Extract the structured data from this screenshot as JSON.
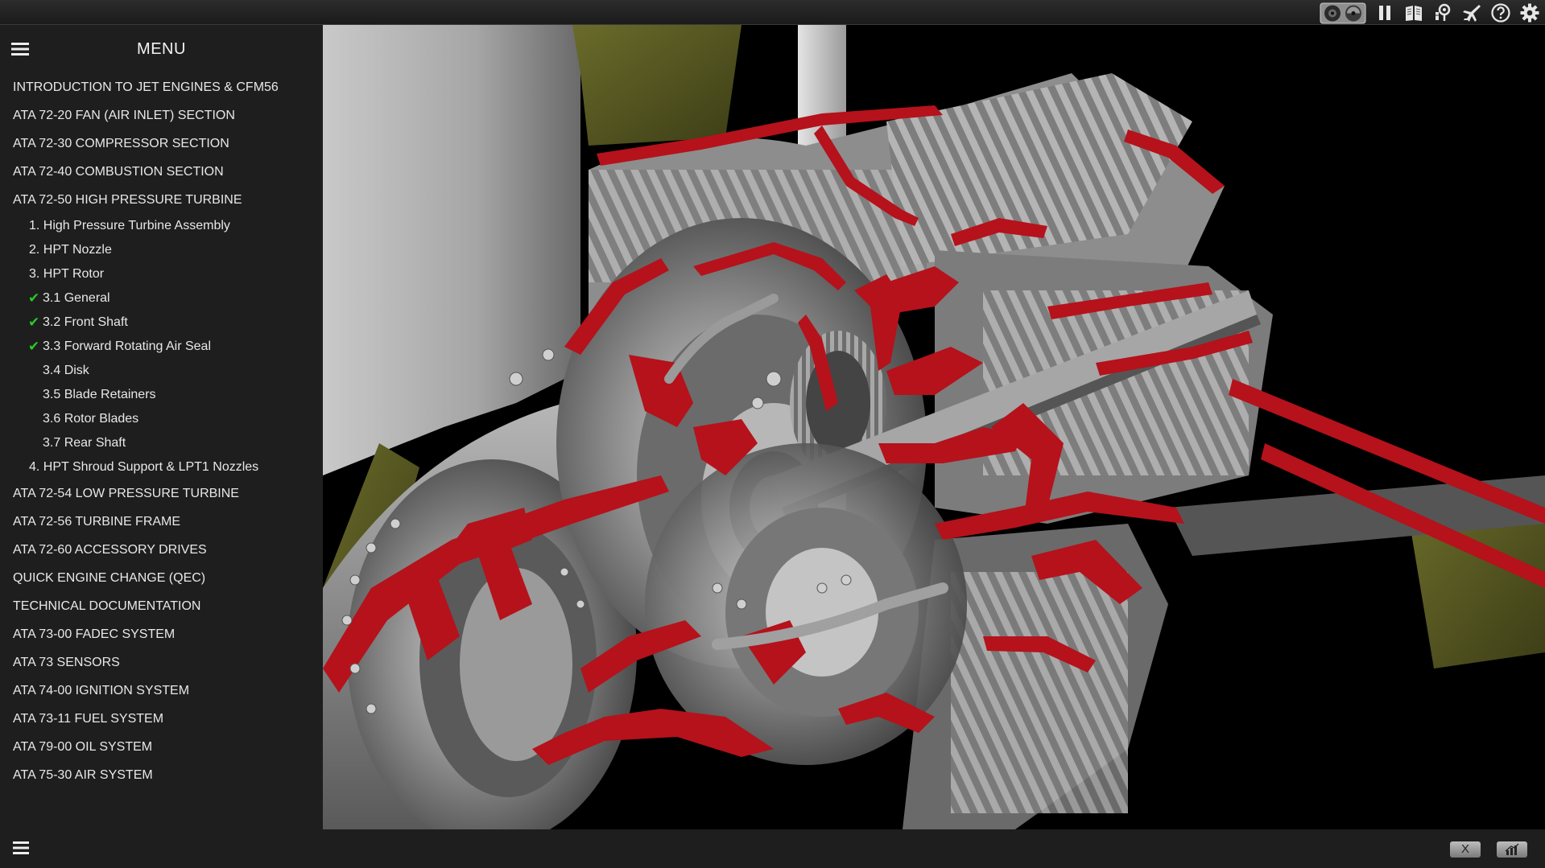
{
  "app": {
    "menu_title": "MENU"
  },
  "toolbar": {
    "icons": [
      "view-toggle-icon",
      "pause-icon",
      "book-icon",
      "location-pin-icon",
      "airplane-icon",
      "help-icon",
      "gear-icon"
    ]
  },
  "menu": {
    "items": [
      {
        "label": "INTRODUCTION TO JET ENGINES & CFM56",
        "level": 0
      },
      {
        "label": "ATA 72-20 FAN (AIR INLET) SECTION",
        "level": 0
      },
      {
        "label": "ATA 72-30 COMPRESSOR SECTION",
        "level": 0
      },
      {
        "label": "ATA 72-40 COMBUSTION SECTION",
        "level": 0
      },
      {
        "label": "ATA 72-50 HIGH PRESSURE TURBINE",
        "level": 0
      },
      {
        "label": "1. High Pressure Turbine Assembly",
        "level": 1
      },
      {
        "label": "2. HPT Nozzle",
        "level": 1
      },
      {
        "label": "3. HPT Rotor",
        "level": 1
      },
      {
        "label": "3.1 General",
        "level": 2,
        "checked": true
      },
      {
        "label": "3.2 Front Shaft",
        "level": 2,
        "checked": true
      },
      {
        "label": "3.3 Forward Rotating Air Seal",
        "level": 2,
        "checked": true
      },
      {
        "label": "3.4 Disk",
        "level": 2,
        "checked": false
      },
      {
        "label": "3.5 Blade Retainers",
        "level": 2,
        "checked": false
      },
      {
        "label": "3.6 Rotor Blades",
        "level": 2,
        "checked": false
      },
      {
        "label": "3.7 Rear Shaft",
        "level": 2,
        "checked": false
      },
      {
        "label": "4. HPT Shroud Support & LPT1 Nozzles",
        "level": 1
      },
      {
        "label": "ATA 72-54 LOW PRESSURE TURBINE",
        "level": 0
      },
      {
        "label": "ATA 72-56 TURBINE FRAME",
        "level": 0
      },
      {
        "label": "ATA 72-60 ACCESSORY DRIVES",
        "level": 0
      },
      {
        "label": "QUICK ENGINE CHANGE (QEC)",
        "level": 0
      },
      {
        "label": "TECHNICAL DOCUMENTATION",
        "level": 0
      },
      {
        "label": "ATA 73-00 FADEC SYSTEM",
        "level": 0
      },
      {
        "label": "ATA 73 SENSORS",
        "level": 0
      },
      {
        "label": "ATA 74-00 IGNITION SYSTEM",
        "level": 0
      },
      {
        "label": "ATA 73-11 FUEL SYSTEM",
        "level": 0
      },
      {
        "label": "ATA 79-00 OIL SYSTEM",
        "level": 0
      },
      {
        "label": "ATA 75-30 AIR SYSTEM",
        "level": 0
      }
    ]
  },
  "bottombar": {
    "close_label": "X"
  },
  "colors": {
    "sidebar_bg": "#1e1e1e",
    "check": "#28c828",
    "section_cut": "#b5121b",
    "metal": "#8a8a8a",
    "nacelle": "#4f5220"
  }
}
